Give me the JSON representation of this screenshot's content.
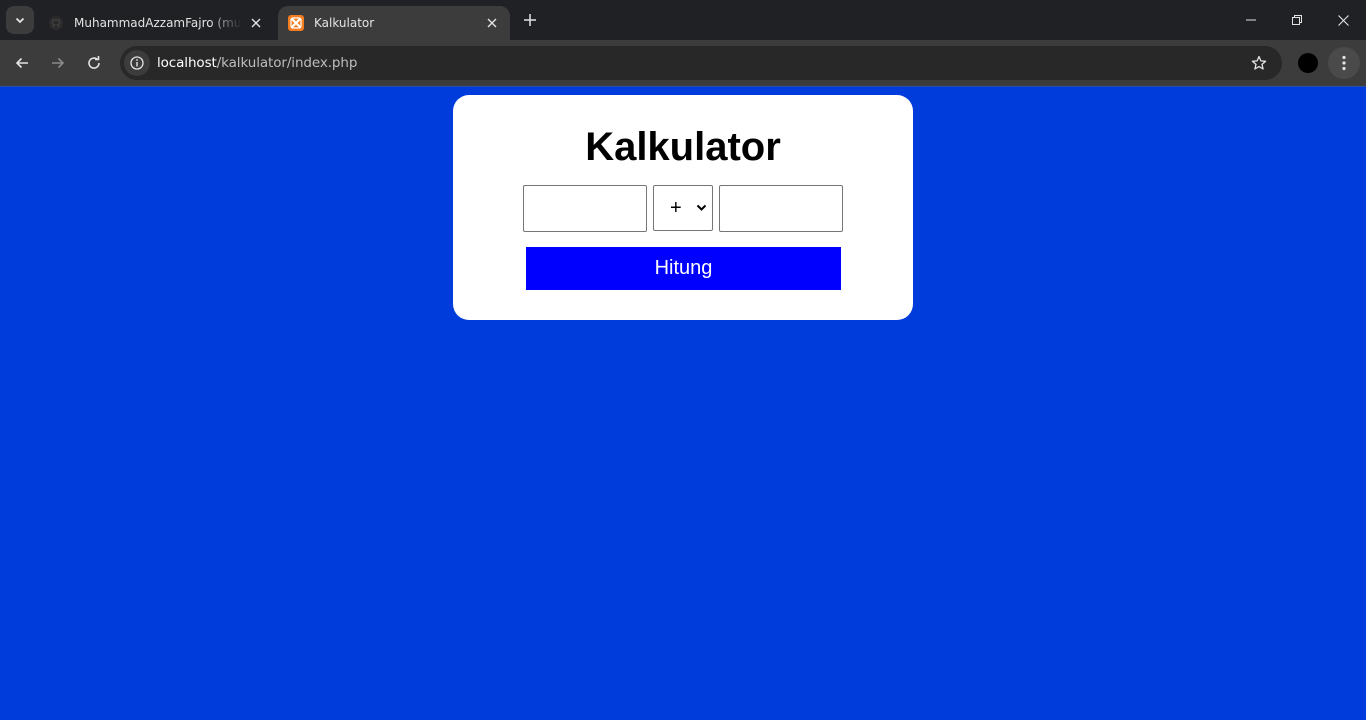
{
  "browser": {
    "tabs": [
      {
        "title": "MuhammadAzzamFajro (muhammadazzamfajro)",
        "favicon": "github-icon",
        "active": false
      },
      {
        "title": "Kalkulator",
        "favicon": "xampp-icon",
        "active": true
      }
    ],
    "address_bar": {
      "host": "localhost",
      "path": "/kalkulator/index.php"
    }
  },
  "page": {
    "background_color": "#003cdc",
    "heading": "Kalkulator",
    "first_number": {
      "value": "",
      "placeholder": ""
    },
    "operator": {
      "selected": "+"
    },
    "second_number": {
      "value": "",
      "placeholder": ""
    },
    "submit_label": "Hitung",
    "button_color": "#0000ff"
  }
}
